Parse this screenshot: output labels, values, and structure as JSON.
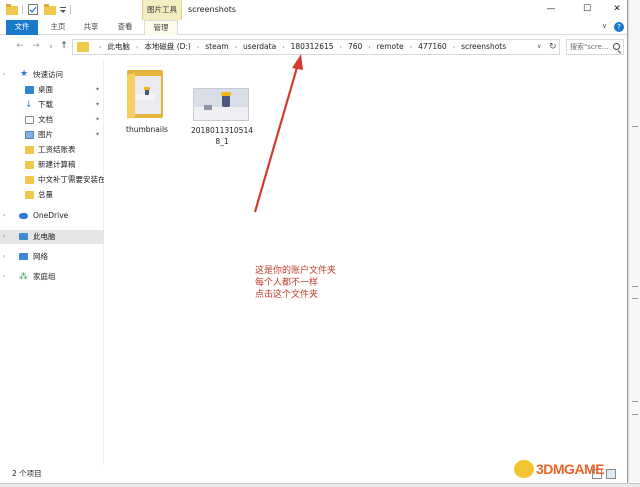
{
  "window": {
    "title": "screenshots",
    "context_group": "图片工具",
    "controls": {
      "minimize": "—",
      "maximize": "☐",
      "close": "✕"
    }
  },
  "ribbon": {
    "tabs": [
      "文件",
      "主页",
      "共享",
      "查看",
      "管理"
    ],
    "active_tab": "文件",
    "collapse_glyph": "∨",
    "help_glyph": "?"
  },
  "address": {
    "crumbs": [
      "此电脑",
      "本地磁盘 (D:)",
      "steam",
      "userdata",
      "180312615",
      "760",
      "remote",
      "477160",
      "screenshots"
    ]
  },
  "search": {
    "placeholder": "搜索\"scre..."
  },
  "nav_pane": {
    "quick_access": "快速访问",
    "items": [
      {
        "label": "桌面",
        "pinned": true
      },
      {
        "label": "下载",
        "pinned": true
      },
      {
        "label": "文档",
        "pinned": true
      },
      {
        "label": "图片",
        "pinned": true
      },
      {
        "label": "工资结账表",
        "pinned": false
      },
      {
        "label": "新建计算稿",
        "pinned": false
      },
      {
        "label": "中文补丁需要安装在",
        "pinned": false
      },
      {
        "label": "总量",
        "pinned": false
      }
    ],
    "onedrive": "OneDrive",
    "this_pc": "此电脑",
    "network": "网络",
    "homegroup": "家庭组"
  },
  "files": [
    {
      "name": "thumbnails",
      "kind": "folder"
    },
    {
      "name": "20180113105148_1",
      "kind": "image"
    }
  ],
  "annotation": {
    "lines": [
      "这是你的账户文件夹",
      "每个人都不一样",
      "点击这个文件夹"
    ],
    "color": "#c0392b"
  },
  "status": {
    "item_count": "2 个项目"
  },
  "watermark": {
    "text": "3DMGAME"
  },
  "colors": {
    "accent": "#1979ca",
    "folder": "#f0c94c",
    "annotation_red": "#d23b2e"
  }
}
